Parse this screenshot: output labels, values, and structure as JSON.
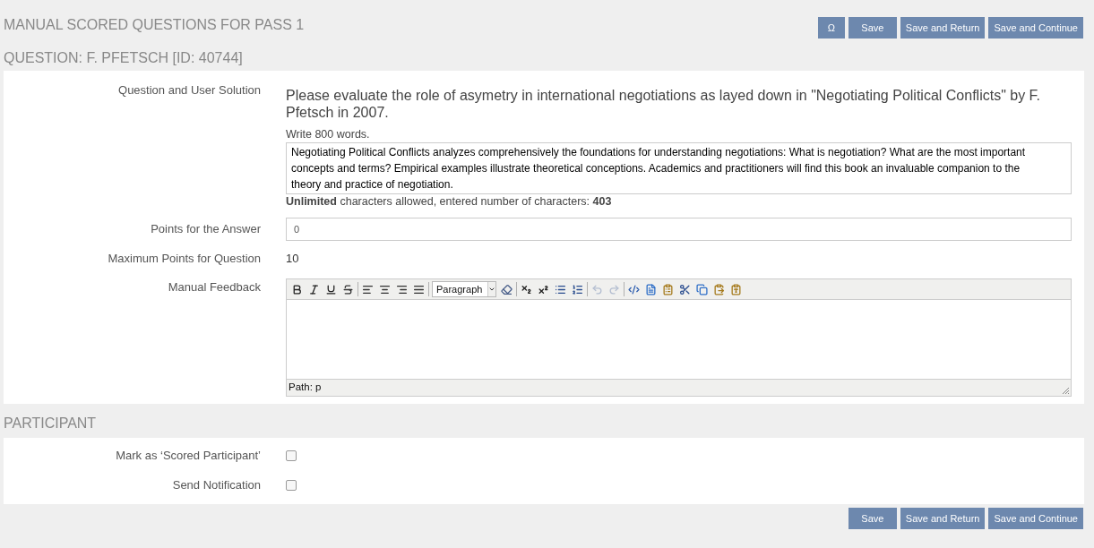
{
  "header": {
    "title": "MANUAL SCORED QUESTIONS FOR PASS 1",
    "buttons": [
      {
        "kind": "symbol",
        "label": "Ω"
      },
      {
        "kind": "text",
        "label": "Save"
      },
      {
        "kind": "text",
        "label": "Save and Return"
      },
      {
        "kind": "text",
        "label": "Save and Continue"
      }
    ]
  },
  "question": {
    "title": "QUESTION: F. PFETSCH [ID: 40744]",
    "rows": [
      {
        "kind": "solution",
        "label": "Question and User Solution",
        "question": "Please evaluate the role of asymetry in international negotiations as layed down in \"Negotiating Political Conflicts\" by F. Pfetsch in 2007.",
        "instruction": "Write 800 words.",
        "answer": "Negotiating Political Conflicts analyzes comprehensively the foundations for understanding negotiations: What is negotiation? What are the most important concepts and terms? Empirical examples illustrate theoretical conceptions. Academics and practitioners will find this book an invaluable companion to the theory and practice of negotiation.",
        "char_info": "**Unlimited** characters allowed, entered number of characters: **403**"
      },
      {
        "kind": "input",
        "label": "Points for the Answer",
        "value": "0"
      },
      {
        "kind": "text",
        "label": "Maximum Points for Question",
        "value": "10"
      },
      {
        "kind": "editor",
        "label": "Manual Feedback",
        "toolbar": [
          {
            "items": [
              {
                "kind": "bold",
                "disabled": false
              },
              {
                "kind": "italic",
                "disabled": false
              },
              {
                "kind": "underline",
                "disabled": false
              },
              {
                "kind": "strikethrough",
                "disabled": false
              }
            ]
          },
          {
            "items": [
              {
                "kind": "align_left",
                "disabled": false
              },
              {
                "kind": "align_center",
                "disabled": false
              },
              {
                "kind": "align_right",
                "disabled": false
              },
              {
                "kind": "align_justify",
                "disabled": false
              }
            ]
          },
          {
            "items": [
              {
                "kind": "select",
                "value": "Paragraph",
                "disabled": false
              },
              {
                "kind": "eraser",
                "disabled": false
              }
            ]
          },
          {
            "items": [
              {
                "kind": "subscript",
                "disabled": false
              },
              {
                "kind": "superscript",
                "disabled": false
              },
              {
                "kind": "bullet_list",
                "disabled": false
              },
              {
                "kind": "numbered_list",
                "disabled": false
              }
            ]
          },
          {
            "items": [
              {
                "kind": "undo",
                "disabled": true
              },
              {
                "kind": "redo",
                "disabled": true
              }
            ]
          },
          {
            "items": [
              {
                "kind": "html",
                "disabled": false
              },
              {
                "kind": "document",
                "disabled": false
              },
              {
                "kind": "paste_list",
                "disabled": false
              },
              {
                "kind": "cut",
                "disabled": false
              },
              {
                "kind": "copy",
                "disabled": false
              },
              {
                "kind": "paste",
                "disabled": false
              },
              {
                "kind": "paste_text",
                "disabled": false
              }
            ]
          }
        ],
        "status": "Path: p"
      }
    ]
  },
  "participant": {
    "title": "PARTICIPANT",
    "rows": [
      {
        "label": "Mark as ‘Scored Participant’",
        "checked": false
      },
      {
        "label": "Send Notification",
        "checked": false
      }
    ]
  },
  "footer_buttons": [
    "Save",
    "Save and Return",
    "Save and Continue"
  ]
}
